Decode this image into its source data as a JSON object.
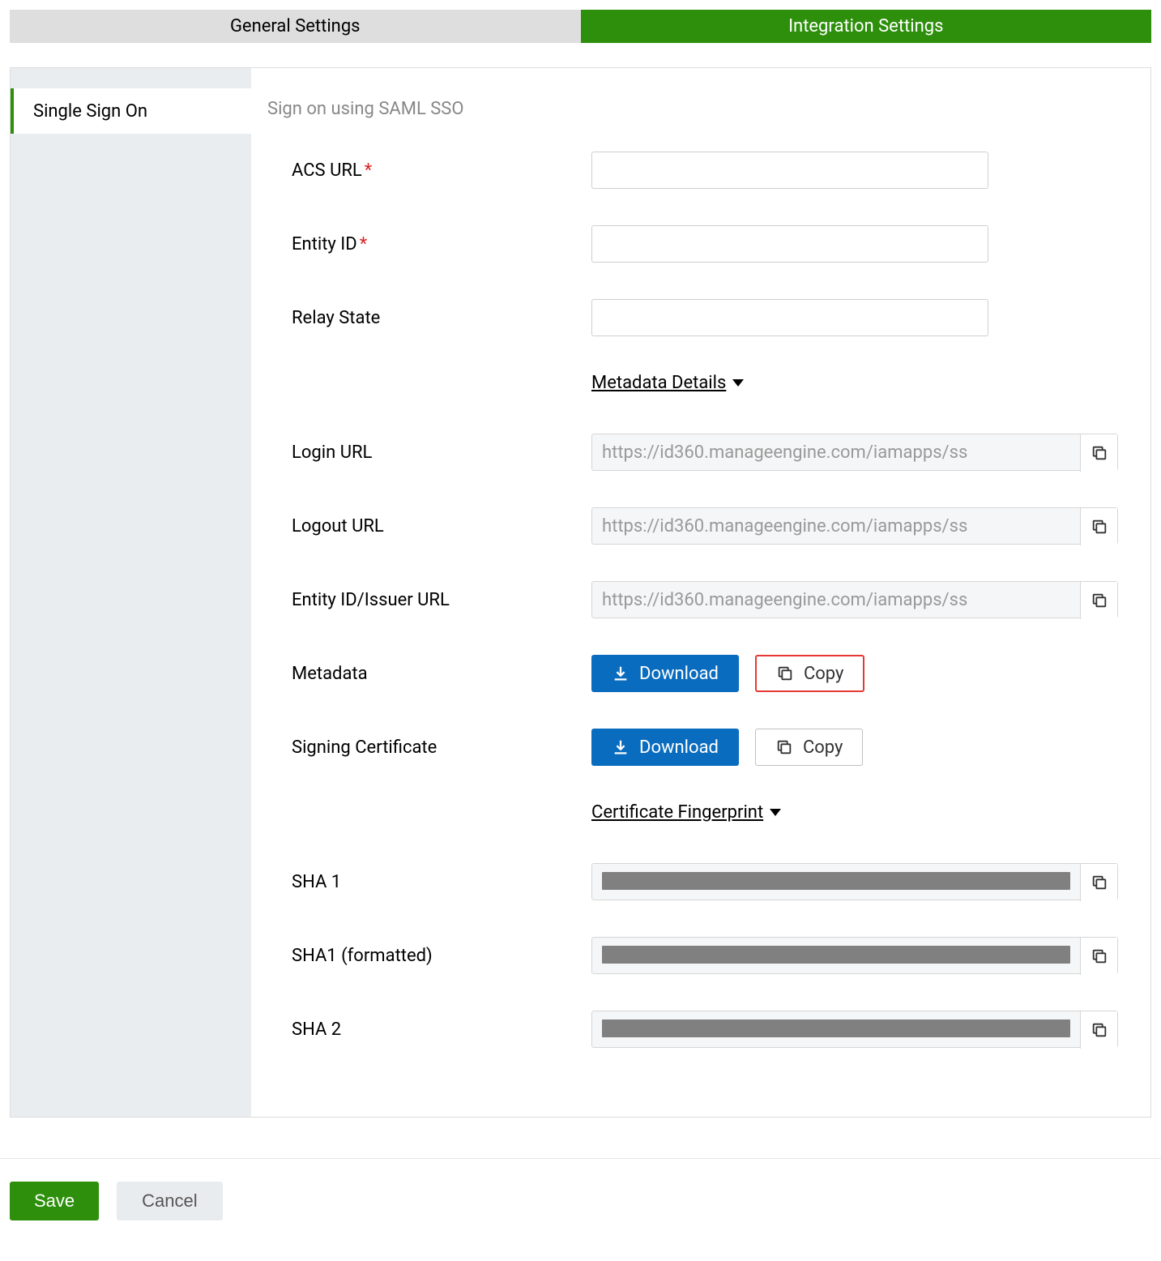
{
  "tabs": {
    "general": "General Settings",
    "integration": "Integration Settings"
  },
  "sidebar": {
    "sso": "Single Sign On"
  },
  "section": {
    "title": "Sign on using SAML SSO"
  },
  "labels": {
    "acs_url": "ACS URL",
    "entity_id": "Entity ID",
    "relay_state": "Relay State",
    "metadata_details": "Metadata Details",
    "login_url": "Login URL",
    "logout_url": "Logout URL",
    "issuer_url": "Entity ID/Issuer URL",
    "metadata": "Metadata",
    "signing_cert": "Signing Certificate",
    "cert_fingerprint": "Certificate Fingerprint",
    "sha1": "SHA 1",
    "sha1_formatted": "SHA1 (formatted)",
    "sha2": "SHA 2"
  },
  "values": {
    "acs_url": "",
    "entity_id": "",
    "relay_state": "",
    "login_url": "https://id360.manageengine.com/iamapps/ss",
    "logout_url": "https://id360.manageengine.com/iamapps/ss",
    "issuer_url": "https://id360.manageengine.com/iamapps/ss"
  },
  "buttons": {
    "download": "Download",
    "copy": "Copy",
    "save": "Save",
    "cancel": "Cancel"
  }
}
